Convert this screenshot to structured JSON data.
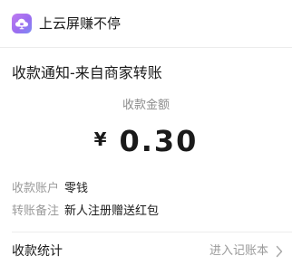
{
  "header": {
    "app_icon": "cloud-screen-app-icon",
    "app_name": "上云屏赚不停"
  },
  "notice": {
    "title": "收款通知-来自商家转账"
  },
  "amount": {
    "label": "收款金额",
    "currency": "¥",
    "value": "0.30"
  },
  "details": {
    "account_key": "收款账户",
    "account_value": "零钱",
    "remark_key": "转账备注",
    "remark_value": "新人注册赠送红包"
  },
  "stats": {
    "label": "收款统计",
    "action": "进入记账本",
    "action_icon": "chevron-right-icon"
  },
  "colors": {
    "logo_gradient_start": "#c07cf0",
    "logo_gradient_end": "#7d8cf4",
    "text_primary": "#1a1a1a",
    "text_secondary": "#9a9a9a"
  }
}
